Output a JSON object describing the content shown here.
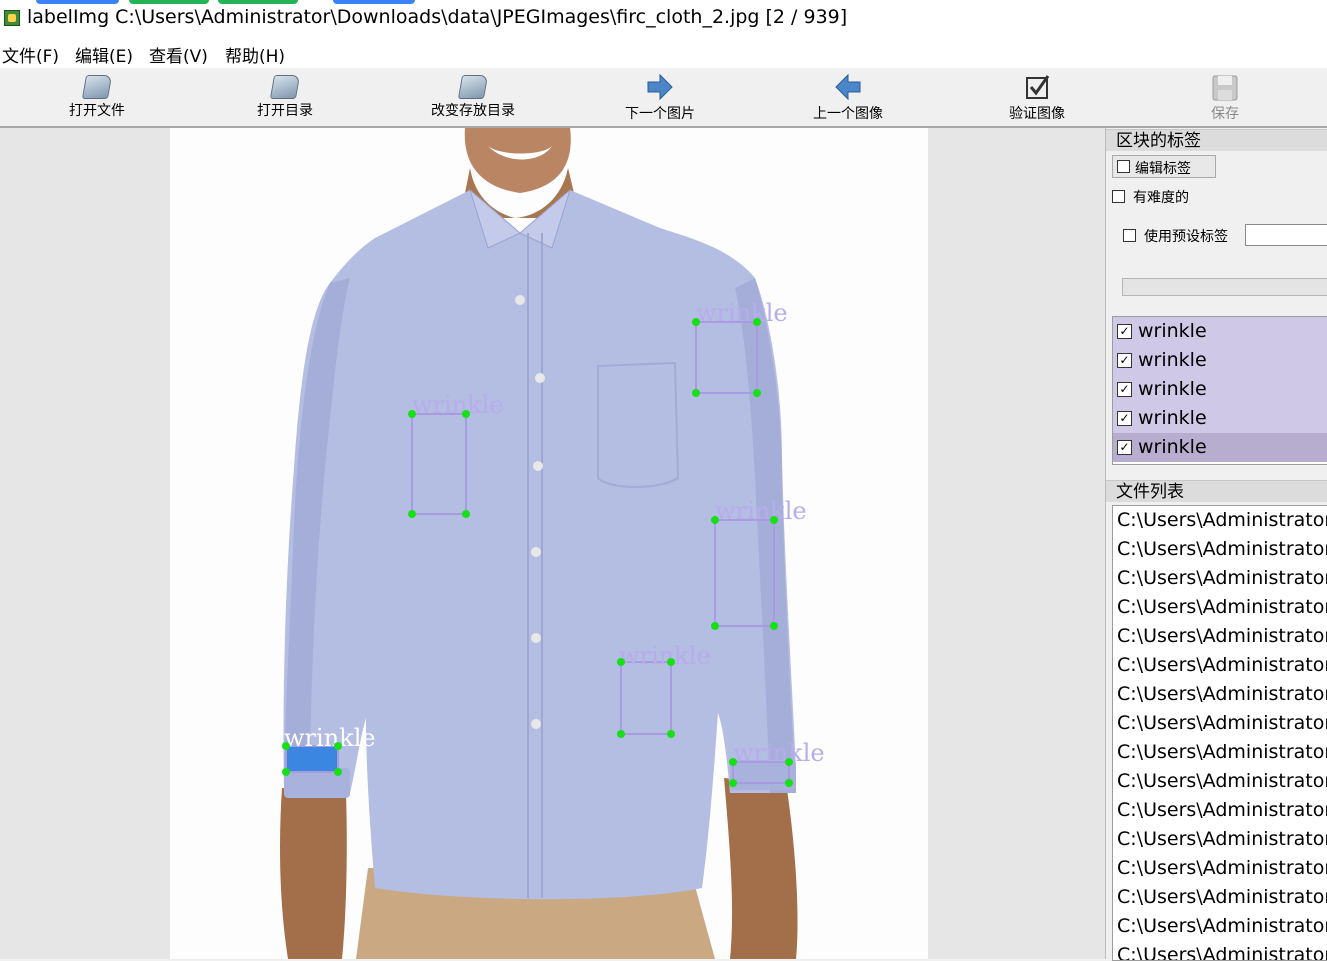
{
  "window": {
    "title": "labelImg C:\\Users\\Administrator\\Downloads\\data\\JPEGImages\\firc_cloth_2.jpg [2 / 939]",
    "icon": "labelimg-app-icon"
  },
  "menu": [
    "文件(F)",
    "编辑(E)",
    "查看(V)",
    "帮助(H)"
  ],
  "toolbar": [
    {
      "label": "打开文件",
      "icon": "open-folder-icon",
      "enabled": true
    },
    {
      "label": "打开目录",
      "icon": "open-folder-icon",
      "enabled": true
    },
    {
      "label": "改变存放目录",
      "icon": "open-folder-icon",
      "enabled": true
    },
    {
      "label": "下一个图片",
      "icon": "arrow-right-icon",
      "enabled": true
    },
    {
      "label": "上一个图像",
      "icon": "arrow-left-icon",
      "enabled": true
    },
    {
      "label": "验证图像",
      "icon": "checkbox-icon",
      "enabled": true
    },
    {
      "label": "保存",
      "icon": "save-disk-icon",
      "enabled": false
    }
  ],
  "canvas": {
    "box_label": "wrinkle",
    "image": "person-wearing-light-blue-shirt"
  },
  "box_labels_dock": {
    "title": "区块的标签",
    "edit_button": "编辑标签",
    "difficult_label": "有难度的",
    "use_default_label": "使用预设标签",
    "labels": [
      "wrinkle",
      "wrinkle",
      "wrinkle",
      "wrinkle",
      "wrinkle"
    ]
  },
  "file_list_dock": {
    "title": "文件列表",
    "files": [
      "C:\\Users\\Administrator",
      "C:\\Users\\Administrator",
      "C:\\Users\\Administrator",
      "C:\\Users\\Administrator",
      "C:\\Users\\Administrator",
      "C:\\Users\\Administrator",
      "C:\\Users\\Administrator",
      "C:\\Users\\Administrator",
      "C:\\Users\\Administrator",
      "C:\\Users\\Administrator",
      "C:\\Users\\Administrator",
      "C:\\Users\\Administrator",
      "C:\\Users\\Administrator",
      "C:\\Users\\Administrator",
      "C:\\Users\\Administrator",
      "C:\\Users\\Administrator"
    ]
  },
  "colors": {
    "box_stroke": "#a99be0",
    "box_selected_fill": "#3a86e0",
    "vertex": "#18e018",
    "label_row_bg": "#cfc8e6",
    "label_row_selected_bg": "#b6adcf"
  }
}
